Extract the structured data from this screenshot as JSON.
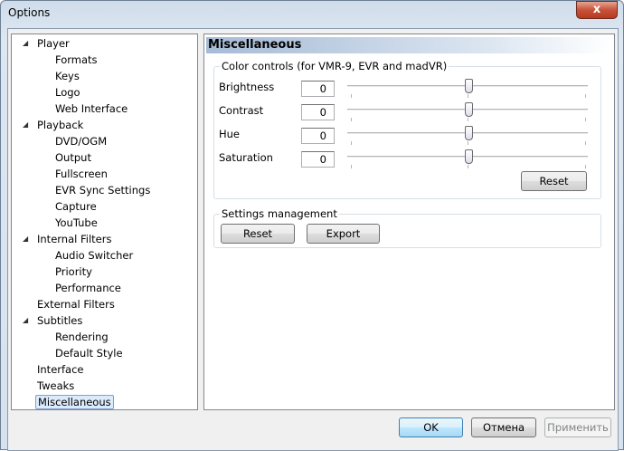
{
  "window": {
    "title": "Options",
    "close": "x"
  },
  "tree": [
    {
      "label": "Player",
      "level": 0,
      "expanded": true
    },
    {
      "label": "Formats",
      "level": 1
    },
    {
      "label": "Keys",
      "level": 1
    },
    {
      "label": "Logo",
      "level": 1
    },
    {
      "label": "Web Interface",
      "level": 1
    },
    {
      "label": "Playback",
      "level": 0,
      "expanded": true
    },
    {
      "label": "DVD/OGM",
      "level": 1
    },
    {
      "label": "Output",
      "level": 1
    },
    {
      "label": "Fullscreen",
      "level": 1
    },
    {
      "label": "EVR Sync Settings",
      "level": 1
    },
    {
      "label": "Capture",
      "level": 1
    },
    {
      "label": "YouTube",
      "level": 1
    },
    {
      "label": "Internal Filters",
      "level": 0,
      "expanded": true
    },
    {
      "label": "Audio Switcher",
      "level": 1
    },
    {
      "label": "Priority",
      "level": 1
    },
    {
      "label": "Performance",
      "level": 1
    },
    {
      "label": "External Filters",
      "level": 0
    },
    {
      "label": "Subtitles",
      "level": 0,
      "expanded": true
    },
    {
      "label": "Rendering",
      "level": 1
    },
    {
      "label": "Default Style",
      "level": 1
    },
    {
      "label": "Interface",
      "level": 0
    },
    {
      "label": "Tweaks",
      "level": 0
    },
    {
      "label": "Miscellaneous",
      "level": 0,
      "selected": true
    }
  ],
  "page": {
    "header": "Miscellaneous",
    "color_controls": {
      "title": "Color controls (for VMR-9, EVR and madVR)",
      "rows": [
        {
          "label": "Brightness",
          "value": "0",
          "slider": 0.5
        },
        {
          "label": "Contrast",
          "value": "0",
          "slider": 0.5
        },
        {
          "label": "Hue",
          "value": "0",
          "slider": 0.5
        },
        {
          "label": "Saturation",
          "value": "0",
          "slider": 0.5
        }
      ],
      "reset": "Reset"
    },
    "settings": {
      "title": "Settings management",
      "reset": "Reset",
      "export": "Export"
    }
  },
  "buttons": {
    "ok": "OK",
    "cancel": "Отмена",
    "apply": "Применить"
  }
}
